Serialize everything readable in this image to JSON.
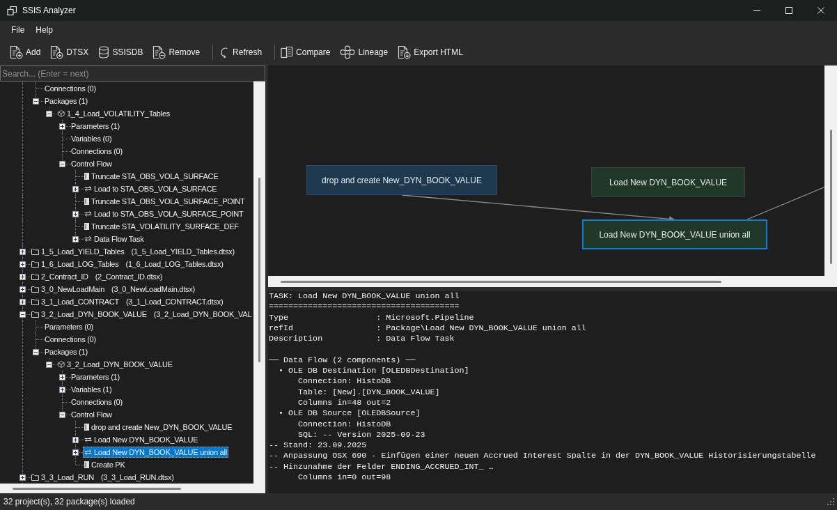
{
  "window": {
    "title": "SSIS Analyzer"
  },
  "menu": [
    "File",
    "Help"
  ],
  "toolbar": [
    {
      "kind": "button",
      "label": "Add"
    },
    {
      "kind": "button",
      "label": "DTSX"
    },
    {
      "kind": "button",
      "label": "SSISDB"
    },
    {
      "kind": "button",
      "label": "Remove"
    },
    {
      "kind": "separator"
    },
    {
      "kind": "button",
      "label": "Refresh"
    },
    {
      "kind": "separator"
    },
    {
      "kind": "button",
      "label": "Compare"
    },
    {
      "kind": "button",
      "label": "Lineage"
    },
    {
      "kind": "button",
      "label": "Export HTML"
    }
  ],
  "search": {
    "placeholder": "Search... (Enter = next)"
  },
  "tree": {
    "continued_branch": [
      {
        "label": "Connections (0)",
        "selected": false
      },
      {
        "label": "Packages (1)",
        "expanded": true,
        "selected": false,
        "children": [
          {
            "label": "1_4_Load_VOLATILITY_Tables",
            "kind": "package",
            "expanded": true,
            "selected": false,
            "children": [
              {
                "label": "Parameters (1)",
                "expanded": false,
                "selected": false
              },
              {
                "label": "Variables (0)",
                "selected": false
              },
              {
                "label": "Connections (0)",
                "selected": false
              },
              {
                "label": "Control Flow",
                "expanded": true,
                "selected": false,
                "children": [
                  {
                    "label": "Truncate STA_OBS_VOLA_SURFACE",
                    "kind": "task",
                    "selected": false
                  },
                  {
                    "label": "Load to STA_OBS_VOLA_SURFACE",
                    "kind": "data_flow",
                    "expanded": false,
                    "selected": false
                  },
                  {
                    "label": "Truncate STA_OBS_VOLA_SURFACE_POINT",
                    "kind": "task",
                    "selected": false
                  },
                  {
                    "label": "Load to STA_OBS_VOLA_SURFACE_POINT",
                    "kind": "data_flow",
                    "expanded": false,
                    "selected": false
                  },
                  {
                    "label": "Truncate STA_VOLATILITY_SURFACE_DEF",
                    "kind": "task",
                    "selected": false
                  },
                  {
                    "label": "Data Flow Task",
                    "kind": "data_flow",
                    "expanded": false,
                    "selected": false
                  }
                ]
              }
            ]
          }
        ]
      }
    ],
    "items": [
      {
        "label": "1_5_Load_YIELD_Tables",
        "file": "(1_5_Load_YIELD_Tables.dtsx)",
        "kind": "project",
        "expanded": false,
        "selected": false
      },
      {
        "label": "1_6_Load_LOG_Tables",
        "file": "(1_6_Load_LOG_Tables.dtsx)",
        "kind": "project",
        "expanded": false,
        "selected": false
      },
      {
        "label": "2_Contract_ID",
        "file": "(2_Contract_ID.dtsx)",
        "kind": "project",
        "expanded": false,
        "selected": false
      },
      {
        "label": "3_0_NewLoadMain",
        "file": "(3_0_NewLoadMain.dtsx)",
        "kind": "project",
        "expanded": false,
        "selected": false
      },
      {
        "label": "3_1_Load_CONTRACT",
        "file": "(3_1_Load_CONTRACT.dtsx)",
        "kind": "project",
        "expanded": false,
        "selected": false
      },
      {
        "label": "3_2_Load_DYN_BOOK_VALUE",
        "file": "(3_2_Load_DYN_BOOK_VAL",
        "kind": "project",
        "expanded": true,
        "selected": false,
        "children": [
          {
            "label": "Parameters (0)",
            "selected": false
          },
          {
            "label": "Connections (0)",
            "selected": false
          },
          {
            "label": "Packages (1)",
            "expanded": true,
            "selected": false,
            "children": [
              {
                "label": "3_2_Load_DYN_BOOK_VALUE",
                "kind": "package",
                "expanded": true,
                "selected": false,
                "children": [
                  {
                    "label": "Parameters (1)",
                    "expanded": false,
                    "selected": false
                  },
                  {
                    "label": "Variables (1)",
                    "expanded": false,
                    "selected": false
                  },
                  {
                    "label": "Connections (0)",
                    "selected": false
                  },
                  {
                    "label": "Control Flow",
                    "expanded": true,
                    "selected": false,
                    "children": [
                      {
                        "label": "drop and create New_DYN_BOOK_VALUE",
                        "kind": "task",
                        "selected": false
                      },
                      {
                        "label": "Load New DYN_BOOK_VALUE",
                        "kind": "data_flow",
                        "expanded": false,
                        "selected": false
                      },
                      {
                        "label": "Load New DYN_BOOK_VALUE union all",
                        "kind": "data_flow",
                        "expanded": false,
                        "selected": true
                      },
                      {
                        "label": "Create PK",
                        "kind": "task",
                        "selected": false
                      }
                    ]
                  }
                ]
              }
            ]
          }
        ]
      },
      {
        "label": "3_3_Load_RUN",
        "file": "(3_3_Load_RUN.dtsx)",
        "kind": "project",
        "expanded": false,
        "selected": false
      }
    ]
  },
  "diagram": {
    "nodes": [
      {
        "label": "drop and create New_DYN_BOOK_VALUE",
        "kind": "sql_task",
        "selected": false
      },
      {
        "label": "Load New DYN_BOOK_VALUE",
        "kind": "data_flow",
        "selected": false
      },
      {
        "label": "Load New DYN_BOOK_VALUE union all",
        "kind": "data_flow",
        "selected": true
      }
    ],
    "edges": [
      {
        "kind": "arrow"
      },
      {
        "kind": "offscreen"
      }
    ]
  },
  "details": {
    "sections": [
      [
        "TASK: Load New DYN_BOOK_VALUE union all",
        "=======================================",
        "Type                  : Microsoft.Pipeline",
        "refId                 : Package\\Load New DYN_BOOK_VALUE union all",
        "Description           : Data Flow Task"
      ],
      [
        "── Data Flow (2 components) ──",
        "  • OLE DB Destination [OLEDBDestination]",
        "      Connection: HistoDB",
        "      Table: [New].[DYN_BOOK_VALUE]",
        "      Columns in=48 out=2",
        "  • OLE DB Source [OLEDBSource]",
        "      Connection: HistoDB",
        "      SQL: -- Version 2025-09-23",
        "-- Stand: 23.09.2025",
        "-- Anpassung OSX 690 - Einfügen einer neuen Accrued Interest Spalte in der DYN_BOOK_VALUE Historisierungstabelle",
        "-- Hinzunahme der Felder ENDING_ACCRUED_INT_ …",
        "      Columns in=0 out=98"
      ]
    ]
  },
  "status_bar": {
    "text": "32 project(s), 32 package(s) loaded"
  }
}
